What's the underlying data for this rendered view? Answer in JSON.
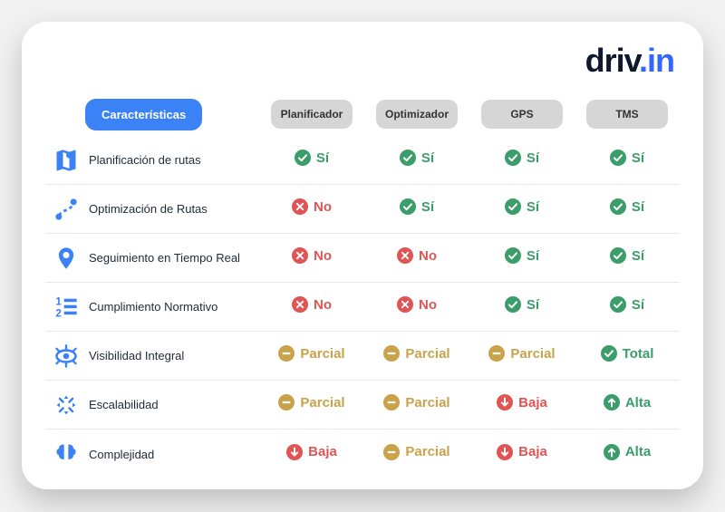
{
  "brand": {
    "name_a": "driv",
    "name_b": ".in"
  },
  "headers": {
    "features": "Características",
    "cols": [
      "Planificador",
      "Optimizador",
      "GPS",
      "TMS"
    ]
  },
  "status_labels": {
    "yes": "Sí",
    "no": "No",
    "partial": "Parcial",
    "low": "Baja",
    "high": "Alta",
    "total": "Total"
  },
  "rows": [
    {
      "icon": "map-icon",
      "label": "Planificación de rutas",
      "cells": [
        "yes",
        "yes",
        "yes",
        "yes"
      ]
    },
    {
      "icon": "route-icon",
      "label": "Optimización de Rutas",
      "cells": [
        "no",
        "yes",
        "yes",
        "yes"
      ]
    },
    {
      "icon": "pin-icon",
      "label": "Seguimiento en Tiempo Real",
      "cells": [
        "no",
        "no",
        "yes",
        "yes"
      ]
    },
    {
      "icon": "list-icon",
      "label": "Cumplimiento Normativo",
      "cells": [
        "no",
        "no",
        "yes",
        "yes"
      ]
    },
    {
      "icon": "visibility-icon",
      "label": "Visibilidad Integral",
      "cells": [
        "partial",
        "partial",
        "partial",
        "total"
      ]
    },
    {
      "icon": "scale-icon",
      "label": "Escalabilidad",
      "cells": [
        "partial",
        "partial",
        "low",
        "high"
      ]
    },
    {
      "icon": "brain-icon",
      "label": "Complejidad",
      "cells": [
        "low",
        "partial",
        "low",
        "high"
      ]
    }
  ]
}
